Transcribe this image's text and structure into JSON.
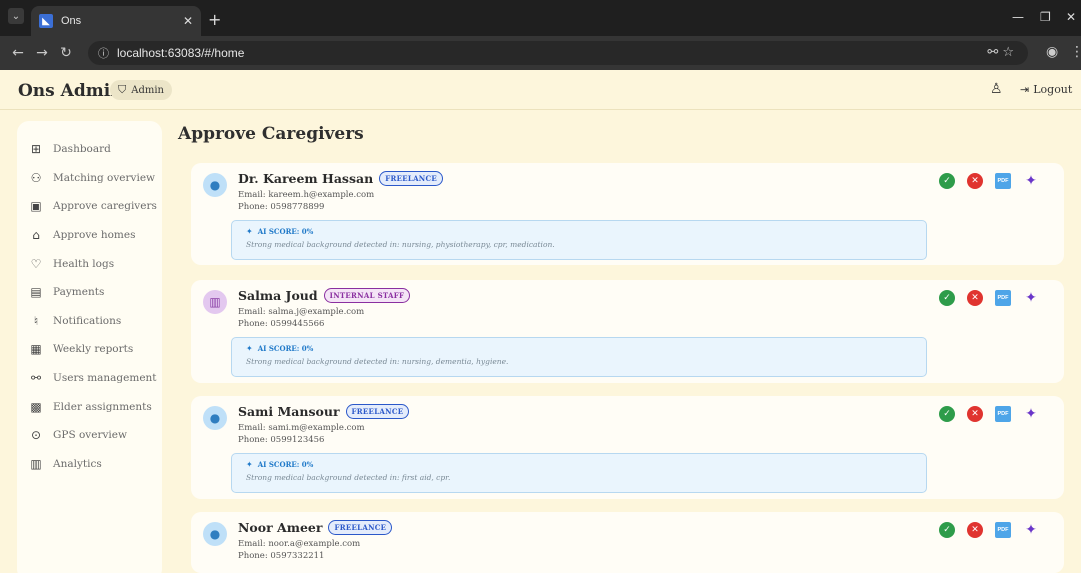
{
  "browser": {
    "tab_title": "Ons",
    "tab_icon": "flutter-icon",
    "url": "localhost:63083/#/home"
  },
  "header": {
    "brand": "Ons Admin",
    "role_chip": "Admin",
    "logout_label": "Logout"
  },
  "sidebar": {
    "items": [
      {
        "label": "Dashboard",
        "icon": "dashboard-icon"
      },
      {
        "label": "Matching overview",
        "icon": "groups-icon"
      },
      {
        "label": "Approve caregivers",
        "icon": "id-badge-icon"
      },
      {
        "label": "Approve homes",
        "icon": "home-icon"
      },
      {
        "label": "Health logs",
        "icon": "heart-icon"
      },
      {
        "label": "Payments",
        "icon": "payments-icon"
      },
      {
        "label": "Notifications",
        "icon": "bell-icon"
      },
      {
        "label": "Weekly reports",
        "icon": "report-icon"
      },
      {
        "label": "Users management",
        "icon": "users-icon"
      },
      {
        "label": "Elder assignments",
        "icon": "assignment-icon"
      },
      {
        "label": "GPS overview",
        "icon": "location-icon"
      },
      {
        "label": "Analytics",
        "icon": "analytics-icon"
      }
    ]
  },
  "main": {
    "title": "Approve Caregivers",
    "caregivers": [
      {
        "name": "Dr. Kareem Hassan",
        "type": "FREELANCE",
        "email": "Email: kareem.h@example.com",
        "phone": "Phone: 0598778899",
        "ai_score": "AI SCORE: 0%",
        "ai_note": "Strong medical background detected in: nursing, physiotherapy, cpr, medication."
      },
      {
        "name": "Salma Joud",
        "type": "INTERNAL STAFF",
        "email": "Email: salma.j@example.com",
        "phone": "Phone: 0599445566",
        "ai_score": "AI SCORE: 0%",
        "ai_note": "Strong medical background detected in: nursing, dementia, hygiene."
      },
      {
        "name": "Sami Mansour",
        "type": "FREELANCE",
        "email": "Email: sami.m@example.com",
        "phone": "Phone: 0599123456",
        "ai_score": "AI SCORE: 0%",
        "ai_note": "Strong medical background detected in: first aid, cpr."
      },
      {
        "name": "Noor Ameer",
        "type": "FREELANCE",
        "email": "Email: noor.a@example.com",
        "phone": "Phone: 0597332211",
        "ai_score": "",
        "ai_note": ""
      }
    ]
  },
  "colors": {
    "background": "#fdf6dc",
    "approve": "#2e9c4a",
    "reject": "#e0342f",
    "pdf": "#4ea5e8",
    "ai": "#6a36c9"
  }
}
